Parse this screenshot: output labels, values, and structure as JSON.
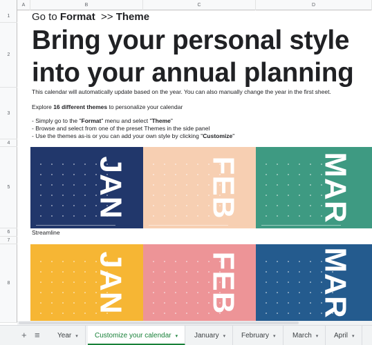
{
  "columns": [
    "A",
    "B",
    "C",
    "D"
  ],
  "rows": [
    "1",
    "2",
    "3",
    "4",
    "5",
    "6",
    "7",
    "8"
  ],
  "header": {
    "go_prefix": "Go to ",
    "go_format": "Format",
    "go_sep": "  >> ",
    "go_theme": "Theme"
  },
  "title": {
    "line1": "Bring your personal style",
    "line2": "into your annual planning"
  },
  "description": "This calendar will automatically update based on the year. You can also manually change the year in the first sheet.",
  "explore": {
    "prefix": "Explore ",
    "bold": "16 different themes",
    "suffix": " to personalize your calendar"
  },
  "steps": {
    "s1_prefix": "-  Simply go to the \"",
    "s1_format": "Format",
    "s1_mid": "\" menu and select \"",
    "s1_theme": "Theme",
    "s1_end": "\"",
    "s2": "-  Browse and select from one of the preset Themes in the side panel",
    "s3_prefix": "-  Use the themes as-is or you can add your own style by clicking \"",
    "s3_bold": "Customize",
    "s3_end": "\""
  },
  "theme_label": "Streamline",
  "panels_row1": [
    {
      "month": "JAN",
      "color": "#21376b"
    },
    {
      "month": "FEB",
      "color": "#f7cfb2"
    },
    {
      "month": "MAR",
      "color": "#3e9a82"
    }
  ],
  "panels_row2": [
    {
      "month": "JAN",
      "color": "#f6b634"
    },
    {
      "month": "FEB",
      "color": "#ed9497"
    },
    {
      "month": "MAR",
      "color": "#245b8e"
    }
  ],
  "tabs": {
    "add_icon": "+",
    "list_icon": "≡",
    "items": [
      {
        "label": "Year"
      },
      {
        "label": "Customize your calendar"
      },
      {
        "label": "January"
      },
      {
        "label": "February"
      },
      {
        "label": "March"
      },
      {
        "label": "April"
      }
    ],
    "caret": "▾"
  }
}
